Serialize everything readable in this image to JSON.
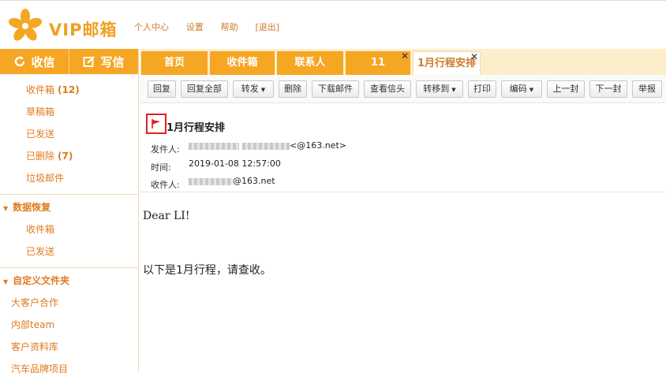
{
  "app": {
    "logo_text": "VIP邮箱"
  },
  "top_links": [
    "个人中心",
    "设置",
    "帮助",
    "[退出]"
  ],
  "sidebar": {
    "receive_label": "收信",
    "compose_label": "写信",
    "folders": [
      {
        "label": "收件箱",
        "count": "(12)"
      },
      {
        "label": "草稿箱",
        "count": ""
      },
      {
        "label": "已发送",
        "count": ""
      },
      {
        "label": "已删除",
        "count": "(7)"
      },
      {
        "label": "垃圾邮件",
        "count": ""
      }
    ],
    "recovery": {
      "title": "数据恢复",
      "items": [
        "收件箱",
        "已发送"
      ]
    },
    "custom": {
      "title": "自定义文件夹",
      "items": [
        "大客户合作",
        "内部team",
        "客户资料库",
        "汽车品牌项目"
      ]
    }
  },
  "tabs": [
    {
      "label": "首页"
    },
    {
      "label": "收件箱"
    },
    {
      "label": "联系人"
    },
    {
      "label": "11"
    },
    {
      "label": "1月行程安排"
    }
  ],
  "toolbar": [
    "回复",
    "回复全部",
    "转发",
    "删除",
    "下载邮件",
    "查看信头",
    "转移到",
    "打印",
    "编码",
    "上一封",
    "下一封",
    "举报"
  ],
  "email": {
    "subject": "1月行程安排",
    "from_label": "发件人:",
    "from_value": "<@163.net>",
    "time_label": "时间:",
    "time_value": "2019-01-08 12:57:00",
    "to_label": "收件人:",
    "to_value": "@163.net",
    "body_lines": [
      "Dear LI!",
      "以下是1月行程，请查收。"
    ]
  },
  "colors": {
    "accent": "#f5a623",
    "link": "#e07a1f",
    "flag": "#e02020"
  }
}
